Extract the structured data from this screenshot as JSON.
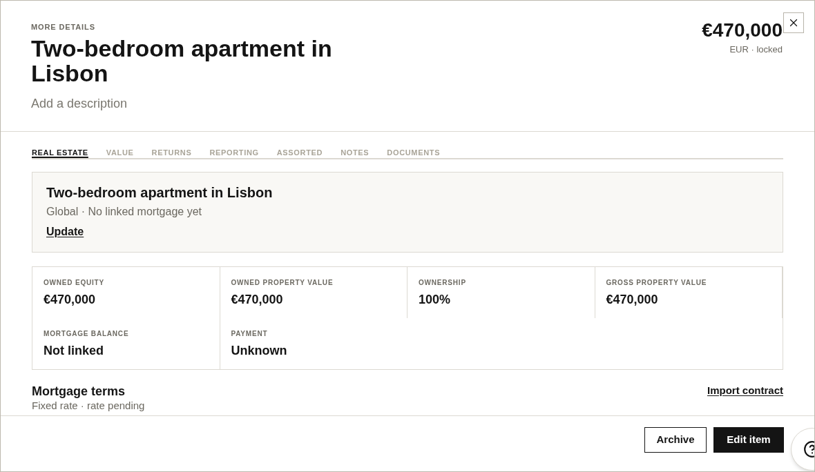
{
  "header": {
    "eyebrow": "MORE DETAILS",
    "title": "Two-bedroom apartment in Lisbon",
    "description": {
      "placeholder": "Add a description"
    },
    "price": "€470,000",
    "price_note": "EUR · locked"
  },
  "tabs": [
    {
      "label": "REAL ESTATE",
      "selected": true
    },
    {
      "label": "VALUE",
      "selected": false
    },
    {
      "label": "RETURNS",
      "selected": false
    },
    {
      "label": "REPORTING",
      "selected": false
    },
    {
      "label": "ASSORTED",
      "selected": false
    },
    {
      "label": "NOTES",
      "selected": false
    },
    {
      "label": "DOCUMENTS",
      "selected": false
    }
  ],
  "property_card": {
    "title": "Two-bedroom apartment in Lisbon",
    "subtitle": "Global · No linked mortgage yet",
    "link": "Update"
  },
  "stats": [
    {
      "label": "OWNED EQUITY",
      "value": "€470,000"
    },
    {
      "label": "OWNED PROPERTY VALUE",
      "value": "€470,000"
    },
    {
      "label": "OWNERSHIP",
      "value": "100%"
    },
    {
      "label": "GROSS PROPERTY VALUE",
      "value": "€470,000"
    },
    {
      "label": "MORTGAGE BALANCE",
      "value": "Not linked"
    },
    {
      "label": "PAYMENT",
      "value": "Unknown"
    }
  ],
  "mortgage_terms": {
    "title": "Mortgage terms",
    "subtitle": "Fixed rate · rate pending",
    "link": "Import contract"
  },
  "footer": {
    "buttons": [
      {
        "label": "Archive",
        "kind": "secondary"
      },
      {
        "label": "Edit item",
        "kind": "primary"
      }
    ]
  }
}
